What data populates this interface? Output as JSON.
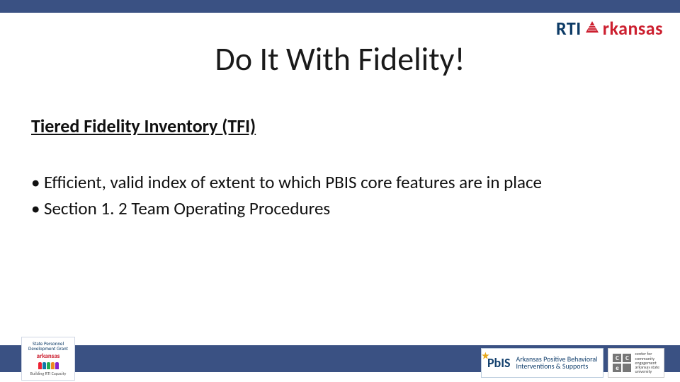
{
  "header": {
    "logo_left": "RTI",
    "logo_right": "rkansas"
  },
  "title": "Do It With Fidelity!",
  "subheading": "Tiered Fidelity Inventory (TFI)",
  "bullets": [
    "Efficient, valid index of extent to which PBIS core features are in place",
    "Section 1. 2 Team Operating Procedures"
  ],
  "footer": {
    "badge_left": {
      "arc_top": "State Personnel Development Grant",
      "name": "arkansas",
      "tagline": "Building RTI Capacity"
    },
    "pbis": {
      "logo": "PbIS",
      "line1": "Arkansas Positive Behavioral",
      "line2": "Interventions & Supports"
    },
    "cce": {
      "letters": [
        "C",
        "C",
        "e",
        ""
      ],
      "line1": "center for",
      "line2": "community",
      "line3": "engagement",
      "line4": "arkansas state",
      "line5": "university"
    }
  }
}
